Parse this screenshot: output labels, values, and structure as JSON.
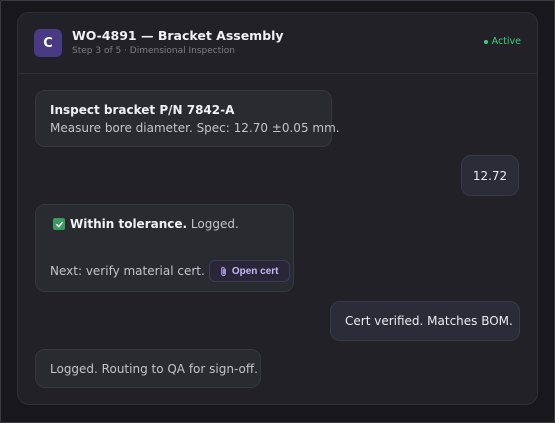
{
  "header": {
    "avatar_letter": "C",
    "title": "WO-4891 — Bracket Assembly",
    "subtitle": "Step 3 of 5 · Dimensional Inspection",
    "status": "Active"
  },
  "messages": [
    {
      "role": "bot",
      "title": "Inspect bracket P/N 7842-A",
      "body": "Measure bore diameter. Spec: 12.70 ±0.05 mm."
    },
    {
      "role": "user",
      "text": "12.72"
    },
    {
      "role": "bot",
      "status_bold": "Within tolerance.",
      "status_text": " Logged.",
      "next_text": "Next: verify material cert.",
      "button_label": "Open cert"
    },
    {
      "role": "user",
      "text": "Cert verified. Matches BOM."
    },
    {
      "role": "bot",
      "text": "Logged. Routing to QA for sign-off."
    }
  ],
  "icons": {
    "status": "status-dot-icon",
    "check": "checkbox-check-icon",
    "attachment": "paperclip-icon"
  },
  "colors": {
    "background": "#17171c",
    "panel": "#212127",
    "avatar": "#4a3a84",
    "status": "#3ccf7f",
    "check": "#3a9a5f",
    "button_text": "#c8b8f8"
  }
}
